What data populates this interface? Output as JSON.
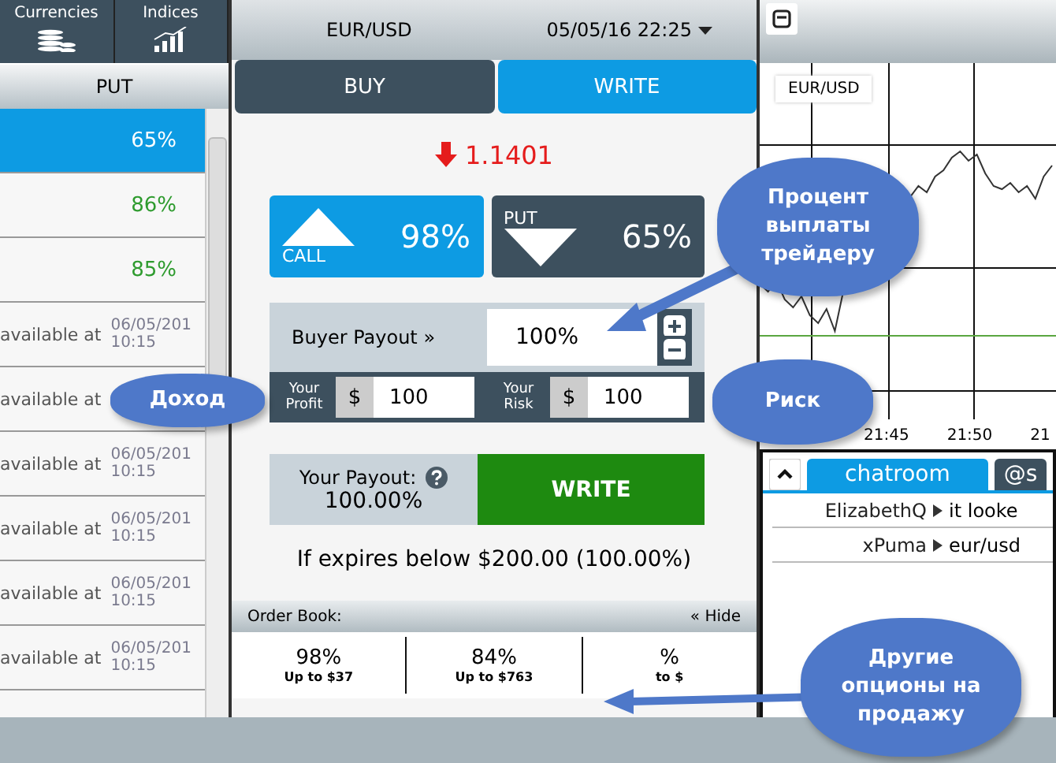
{
  "sidebar": {
    "tabs": [
      {
        "label": "Currencies",
        "kind": "coins"
      },
      {
        "label": "Indices",
        "kind": "bars"
      }
    ],
    "column": "PUT",
    "rows": [
      {
        "kind": "payout",
        "value": "65%",
        "selected": true
      },
      {
        "kind": "payout",
        "value": "86%",
        "selected": false
      },
      {
        "kind": "payout",
        "value": "85%",
        "selected": false
      },
      {
        "kind": "pending",
        "text": "available at",
        "date": "06/05/201",
        "time": "10:15",
        "selected": false
      },
      {
        "kind": "pending",
        "text": "available at",
        "selected": false
      },
      {
        "kind": "pending",
        "text": "available at",
        "date": "06/05/201",
        "time": "10:15",
        "selected": false
      },
      {
        "kind": "pending",
        "text": "available at",
        "date": "06/05/201",
        "time": "10:15",
        "selected": false
      },
      {
        "kind": "pending",
        "text": "available at",
        "date": "06/05/201",
        "time": "10:15",
        "selected": false
      },
      {
        "kind": "pending",
        "text": "available at",
        "date": "06/05/201",
        "time": "10:15",
        "selected": false
      }
    ]
  },
  "trade": {
    "pair": "EUR/USD",
    "datetime": "05/05/16 22:25",
    "tabs": [
      {
        "label": "BUY",
        "selected": false
      },
      {
        "label": "WRITE",
        "selected": true
      }
    ],
    "price": "1.1401",
    "falling": true,
    "options": [
      {
        "kind": "call",
        "label": "CALL",
        "payout": "98%",
        "selected": true
      },
      {
        "kind": "put",
        "label": "PUT",
        "payout": "65%",
        "selected": false
      }
    ],
    "buyer_payout": {
      "label": "Buyer Payout »",
      "value": "100%"
    },
    "amounts": [
      {
        "label": "Your",
        "label2": "Profit",
        "currency": "$",
        "value": "100"
      },
      {
        "label": "Your",
        "label2": "Risk",
        "currency": "$",
        "value": "100"
      }
    ],
    "your_payout": {
      "label": "Your Payout:",
      "value": "100.00%"
    },
    "action": "WRITE",
    "summary": "If expires below $200.00 (100.00%)",
    "order_book": {
      "title": "Order Book:",
      "toggle": "« Hide",
      "entries": [
        {
          "percent": "98%",
          "limit": "Up to $37"
        },
        {
          "percent": "84%",
          "limit": "Up to $763"
        },
        {
          "percent": "%",
          "limit": "to $"
        }
      ]
    }
  },
  "chart": {
    "symbol": "EUR/USD",
    "xticks": [
      "21:45",
      "21:50",
      "21"
    ]
  },
  "chat": {
    "tabs": [
      {
        "label": "chatroom",
        "selected": true
      },
      {
        "label": "@s",
        "selected": false
      }
    ],
    "messages": [
      {
        "name": "ElizabethQ",
        "text": "it looke"
      },
      {
        "name": "xPuma",
        "text": "eur/usd"
      }
    ]
  },
  "annotations": [
    {
      "kind": "payout",
      "text": "Процент выплаты трейдеру"
    },
    {
      "kind": "income",
      "text": "Доход"
    },
    {
      "kind": "risk",
      "text": "Риск"
    },
    {
      "kind": "offers",
      "text": "Другие опционы на продажу"
    }
  ]
}
